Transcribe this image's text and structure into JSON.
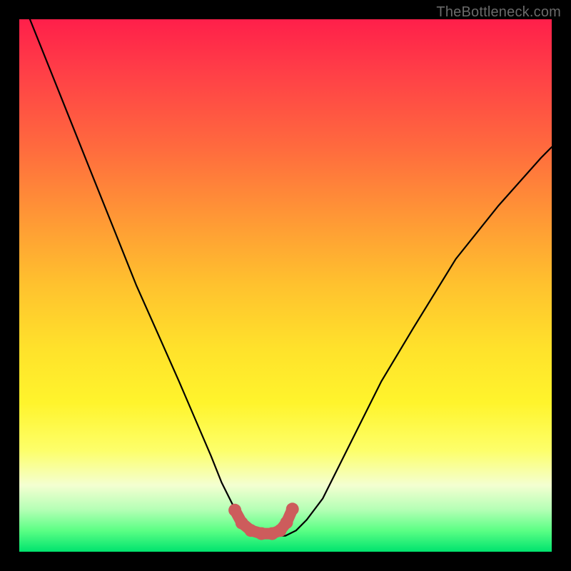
{
  "watermark": "TheBottleneck.com",
  "chart_data": {
    "type": "line",
    "title": "",
    "xlabel": "",
    "ylabel": "",
    "xlim": [
      0,
      100
    ],
    "ylim": [
      0,
      100
    ],
    "grid": false,
    "note": "Bottleneck curve over a green→red gradient. No axes/ticks/legend shown. X and Y are normalized 0–100 (left→right, bottom→top).",
    "series": [
      {
        "name": "bottleneck-curve",
        "color": "#000000",
        "x": [
          2,
          6,
          10,
          14,
          18,
          22,
          26,
          30,
          33,
          36,
          38,
          40,
          42,
          44,
          46,
          48,
          50,
          52,
          54,
          57,
          60,
          64,
          68,
          74,
          82,
          90,
          98,
          100
        ],
        "values": [
          100,
          90,
          80,
          70,
          60,
          50,
          41,
          32,
          25,
          18,
          13,
          9,
          6,
          4,
          3,
          3,
          3,
          4,
          6,
          10,
          16,
          24,
          32,
          42,
          55,
          65,
          74,
          76
        ]
      },
      {
        "name": "optimum-cluster",
        "color": "#cd5c5c",
        "x": [
          40.5,
          41.8,
          43.5,
          45.5,
          47.5,
          49.0,
          50.2,
          51.3
        ],
        "values": [
          7.8,
          5.4,
          4.0,
          3.4,
          3.4,
          4.0,
          5.5,
          8.0
        ]
      }
    ]
  }
}
